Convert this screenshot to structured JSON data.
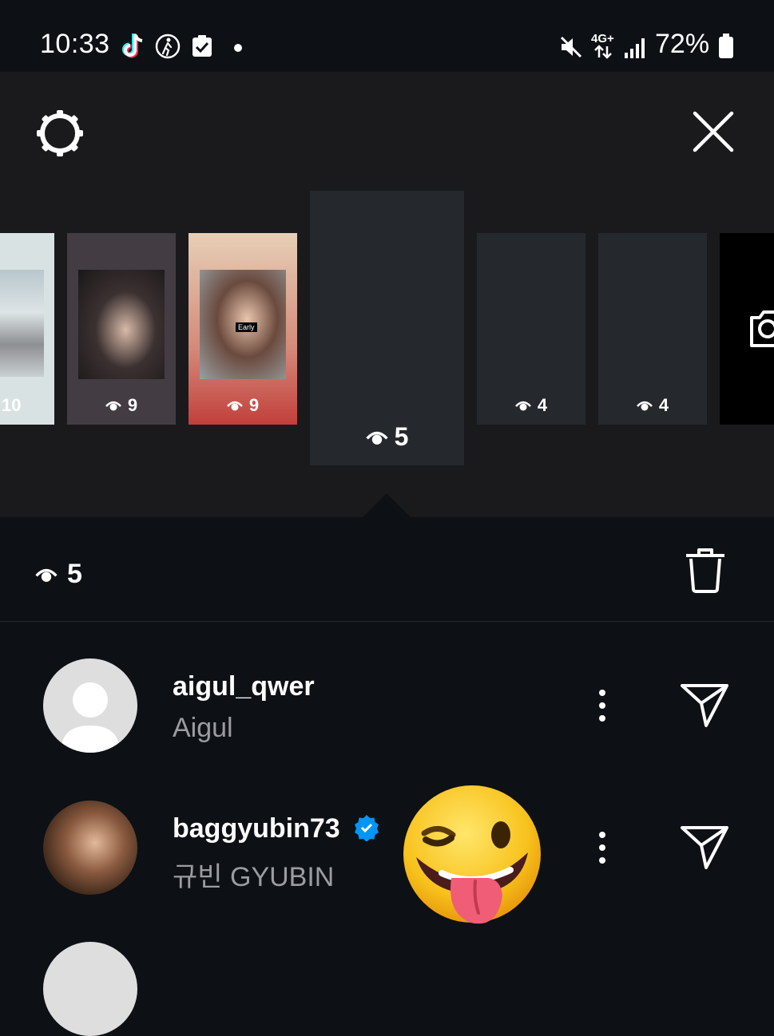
{
  "status_bar": {
    "time": "10:33",
    "network": "4G+",
    "battery": "72%",
    "left_icons": [
      "tiktok-icon",
      "walking-icon",
      "checkbox-icon",
      "dot-icon"
    ],
    "right_icons": [
      "mute-icon",
      "network-arrows-icon",
      "signal-icon",
      "battery-icon"
    ]
  },
  "story_strip": {
    "items": [
      {
        "views": "10",
        "bg": "#d9e2e2"
      },
      {
        "views": "9",
        "bg": "#433c43"
      },
      {
        "views": "9",
        "bg": "#c23f3b",
        "sticker": "Early"
      },
      {
        "views": "5",
        "bg": "#25282d",
        "selected": true
      },
      {
        "views": "4",
        "bg": "#25282d"
      },
      {
        "views": "4",
        "bg": "#25282d"
      }
    ]
  },
  "viewers": {
    "count": "5",
    "list": [
      {
        "username": "aigul_qwer",
        "name": "Aigul",
        "verified": false
      },
      {
        "username": "baggyubin73",
        "name": "규빈 GYUBIN",
        "verified": true
      }
    ]
  },
  "colors": {
    "background": "#0d1015",
    "panel": "#1a1a1c",
    "verified": "#0095f6",
    "secondary_text": "#9a9ca1"
  }
}
